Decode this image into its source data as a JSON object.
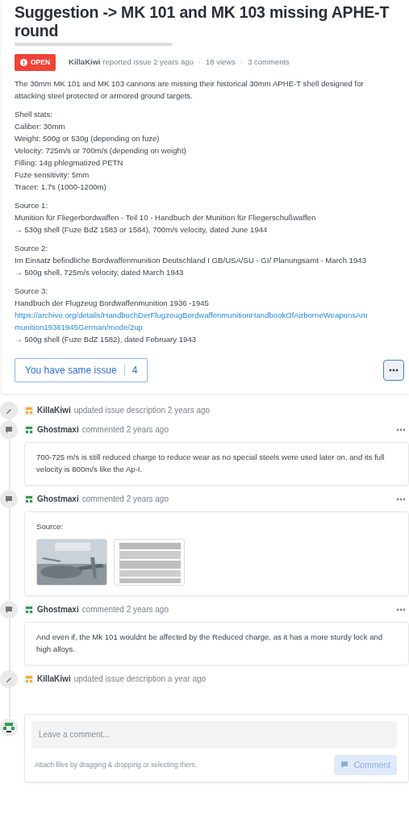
{
  "issue": {
    "title": "Suggestion -> MK 101 and MK 103 missing APHE-T round",
    "status": {
      "kind": "open",
      "label": "OPEN"
    },
    "author": "KillaKiwi",
    "action": "reported issue 2 years ago",
    "separator": "·",
    "views": "18 views",
    "comments": "3 comments",
    "body": [
      {
        "lines": [
          {
            "kind": "text",
            "text": "The 30mm MK 101 and MK 103 cannons are missing their historical 30mm APHE-T shell designed for attacking steel protected or armored ground targets."
          }
        ]
      },
      {
        "lines": [
          {
            "kind": "text",
            "text": "Shell stats:"
          },
          {
            "kind": "text",
            "text": "Caliber: 30mm"
          },
          {
            "kind": "text",
            "text": "Weight: 500g or 530g (depending on fuze)"
          },
          {
            "kind": "text",
            "text": "Velocity: 725m/s or 700m/s (depending on weight)"
          },
          {
            "kind": "text",
            "text": "Filling: 14g phlegmatized PETN"
          },
          {
            "kind": "text",
            "text": "Fuze sensitivity: 5mm"
          },
          {
            "kind": "text",
            "text": "Tracer: 1.7s (1000-1200m)"
          }
        ]
      },
      {
        "lines": [
          {
            "kind": "text",
            "text": "Source 1:"
          },
          {
            "kind": "text",
            "text": "Munition für Fliegerbordwaffen - Teil 10 - Handbuch der Munition für Fliegerschußwaffen"
          },
          {
            "kind": "text",
            "text": "→ 530g shell (Fuze BdZ 1583 or 1584), 700m/s velocity, dated June 1944"
          }
        ]
      },
      {
        "lines": [
          {
            "kind": "text",
            "text": "Source 2:"
          },
          {
            "kind": "text",
            "text": "Im Einsatz befindliche Bordwaffenmunition Deutschland I GB/USA/SU - GI/ Planungsamt - March 1943"
          },
          {
            "kind": "text",
            "text": "→ 500g shell, 725m/s velocity, dated March 1943"
          }
        ]
      },
      {
        "lines": [
          {
            "kind": "text",
            "text": "Source 3:"
          },
          {
            "kind": "text",
            "text": "Handbuch der Flugzeug Bordwaffenmunition 1936 -1945"
          },
          {
            "kind": "link",
            "text": "https://archive.org/details/HandbuchDerFlugzeugBordwaffenmunitionHandbookOfAirborneWeaponsAmmunition19361945German/mode/2up"
          },
          {
            "kind": "text",
            "text": "→ 500g shell (Fuze BdZ 1582), dated February 1943"
          }
        ]
      }
    ],
    "same_issue": {
      "label": "You have same issue",
      "count": "4"
    }
  },
  "timeline": [
    {
      "kind": "update",
      "author": "KillaKiwi",
      "color": "#f2b01e",
      "action": "updated issue description 2 years ago"
    },
    {
      "kind": "comment",
      "author": "Ghostmaxi",
      "color": "#2f9a52",
      "action": "commented 2 years ago",
      "text": "700-725 m/s is still reduced charge to reduce wear as no special steels were used later on, and its full velocity is 800m/s like the Ap-I."
    },
    {
      "kind": "comment",
      "author": "Ghostmaxi",
      "color": "#2f9a52",
      "action": "commented 2 years ago",
      "text": "Source:"
    },
    {
      "kind": "comment",
      "author": "Ghostmaxi",
      "color": "#2f9a52",
      "action": "commented 2 years ago",
      "text": "And even if, the Mk 101 wouldnt be affected by the Reduced charge, as it has a more sturdy lock and high alloys."
    },
    {
      "kind": "update",
      "author": "KillaKiwi",
      "color": "#f2b01e",
      "action": "updated issue description a year ago"
    }
  ],
  "composer": {
    "placeholder": "Leave a comment...",
    "hint": "Attach files by dragging & dropping or selecting them.",
    "button": {
      "label": "Comment",
      "disabled": true
    }
  }
}
